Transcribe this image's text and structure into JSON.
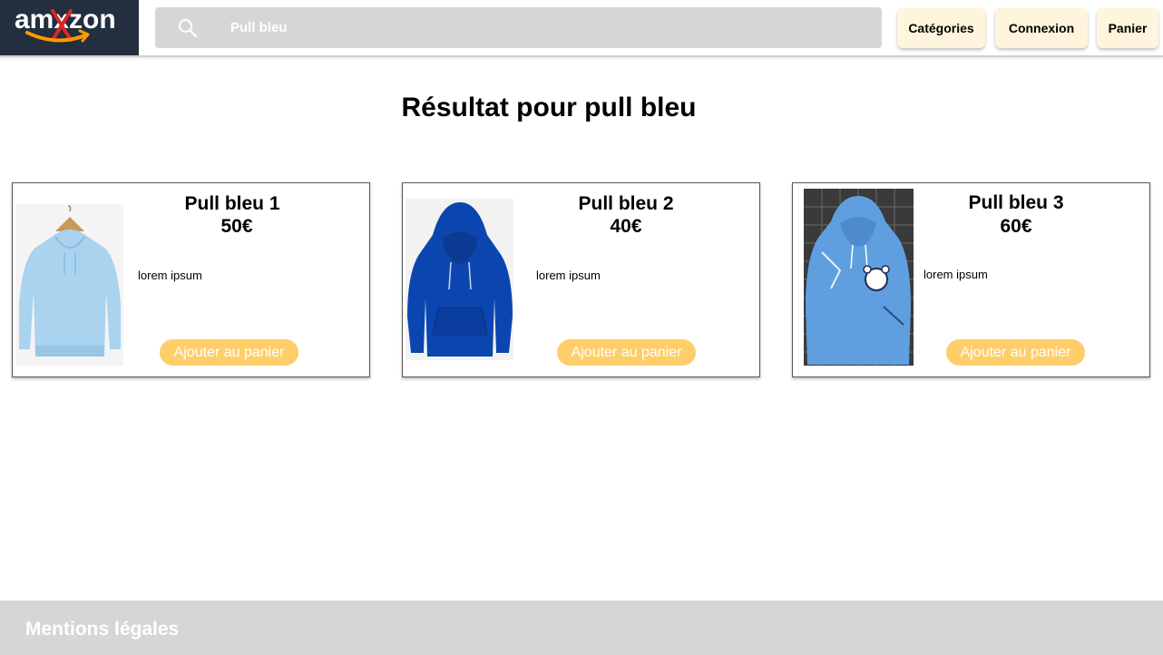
{
  "header": {
    "logo_text": "amxzon",
    "search_value": "Pull bleu",
    "nav": [
      "Catégories",
      "Connexion",
      "Panier"
    ]
  },
  "page_title": "Résultat pour pull bleu",
  "products": [
    {
      "name": "Pull bleu 1",
      "price": "50€",
      "description": "lorem ipsum",
      "button": "Ajouter au panier"
    },
    {
      "name": "Pull bleu 2",
      "price": "40€",
      "description": "lorem ipsum",
      "button": "Ajouter au panier"
    },
    {
      "name": "Pull bleu 3",
      "price": "60€",
      "description": "lorem ipsum",
      "button": "Ajouter au panier"
    }
  ],
  "footer": {
    "legal_link": "Mentions légales"
  },
  "colors": {
    "logo_bg": "#232f3e",
    "accent": "#ffcd6a",
    "nav_bg": "#fff5dc",
    "search_bg": "#d6d6d6"
  },
  "icons": [
    "search-icon",
    "amazon-smile-icon"
  ]
}
